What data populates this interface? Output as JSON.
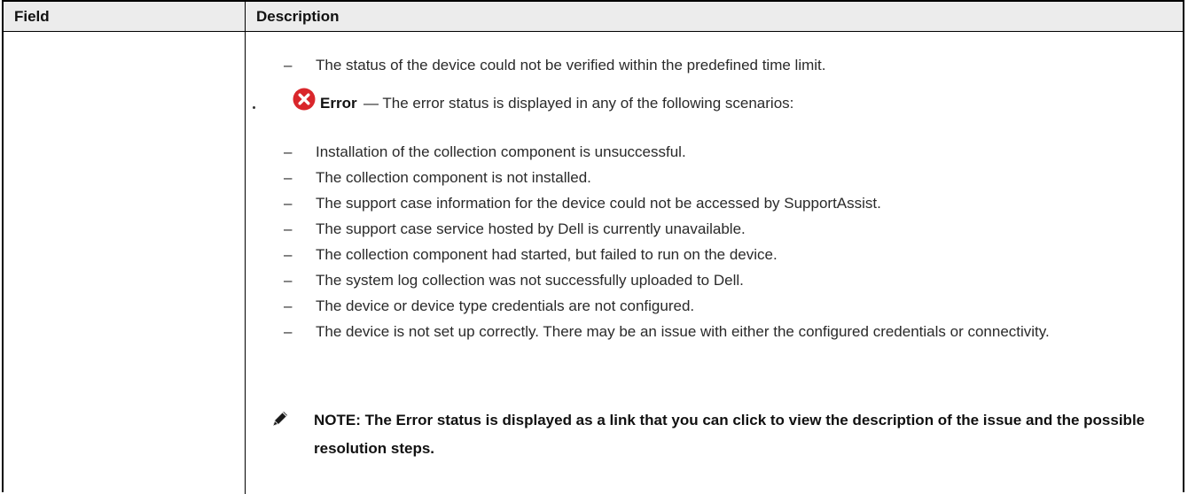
{
  "table": {
    "header": {
      "field": "Field",
      "description": "Description"
    },
    "first_item": "The status of the device could not be verified within the predefined time limit.",
    "error_bullet": {
      "icon": "error-circle-x-icon",
      "icon_color": "#d9262b",
      "label": "Error",
      "description": "— The error status is displayed in any of the following scenarios:"
    },
    "scenarios": [
      "Installation of the collection component is unsuccessful.",
      "The collection component is not installed.",
      "The support case information for the device could not be accessed by SupportAssist.",
      "The support case service hosted by Dell is currently unavailable.",
      "The collection component had started, but failed to run on the device.",
      "The system log collection was not successfully uploaded to Dell.",
      "The device or device type credentials are not configured.",
      "The device is not set up correctly. There may be an issue with either the configured credentials or connectivity."
    ],
    "note": {
      "icon": "pencil-note-icon",
      "text": "NOTE: The Error status is displayed as a link that you can click to view the description of the issue and the possible resolution steps."
    }
  }
}
